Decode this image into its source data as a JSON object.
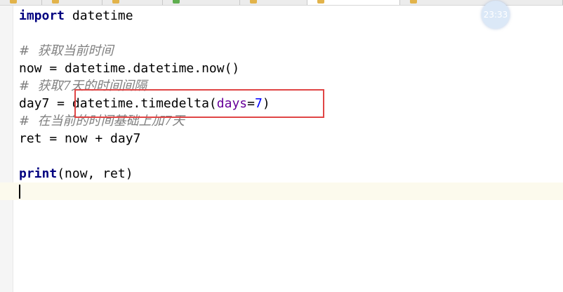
{
  "tabs": [
    {
      "state": "inactive",
      "mark_color": "#e2b34a"
    },
    {
      "state": "inactive",
      "mark_color": "#e2b34a"
    },
    {
      "state": "inactive",
      "mark_color": "#e2b34a"
    },
    {
      "state": "inactive",
      "mark_color": "#5fae4f"
    },
    {
      "state": "inactive",
      "mark_color": "#e2b34a"
    },
    {
      "state": "active",
      "mark_color": "#e2b34a"
    },
    {
      "state": "inactive",
      "mark_color": "#e2b34a"
    }
  ],
  "clock": {
    "time": "23:33"
  },
  "code": {
    "line1": {
      "kw": "import",
      "rest": " datetime"
    },
    "line3": {
      "comment": "#  获取当前时间"
    },
    "line4": {
      "text": "now = datetime.datetime.now()"
    },
    "line5": {
      "comment": "#  获取7天的时间间隔"
    },
    "line6": {
      "prefix": "day7 = datetime.timedelta(",
      "param": "days",
      "eq": "=",
      "num": "7",
      "suffix": ")"
    },
    "line7": {
      "comment": "#  在当前的时间基础上加7天"
    },
    "line8": {
      "text": "ret = now + day7"
    },
    "line10": {
      "kw": "print",
      "rest": "(now, ret)"
    }
  },
  "colors": {
    "keyword": "#000080",
    "comment": "#808080",
    "param": "#660099",
    "number": "#0000ff",
    "highlight_box": "#e04545",
    "current_line": "#fcfaed"
  }
}
